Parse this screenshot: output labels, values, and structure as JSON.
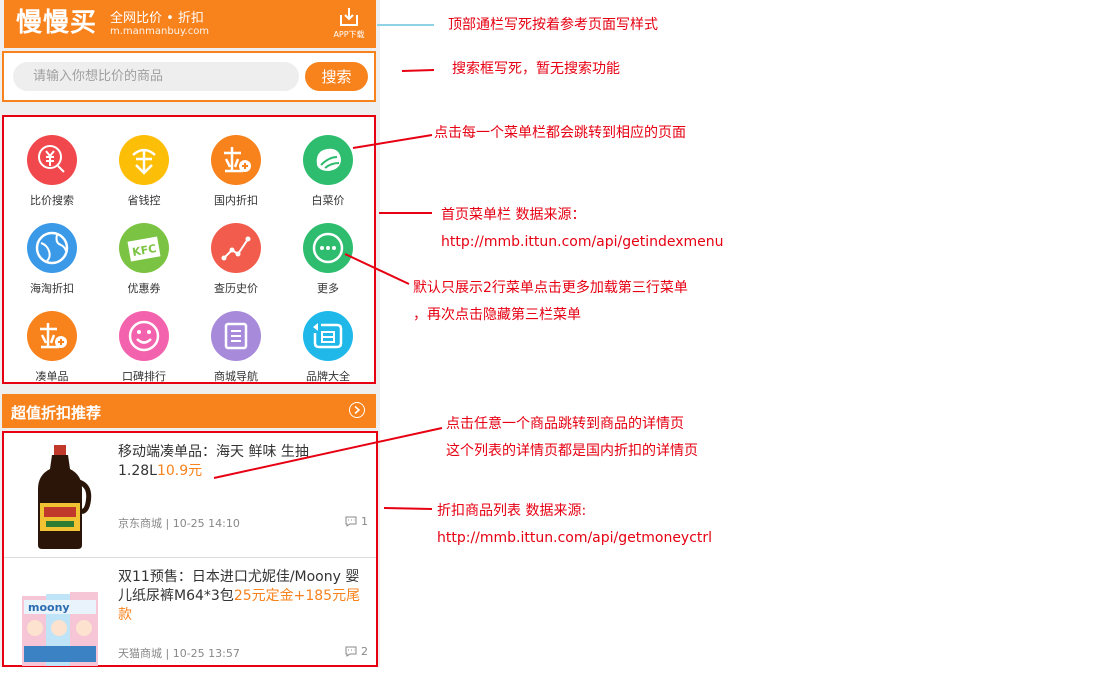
{
  "header": {
    "logo": "慢慢买",
    "slogan": "全网比价 • 折扣",
    "domain": "m.manmanbuy.com",
    "app_download_label": "APP下载",
    "bg_color": "#f8821c"
  },
  "search": {
    "placeholder": "请输入你想比价的商品",
    "button_label": "搜索"
  },
  "menu": {
    "items": [
      {
        "label": "比价搜索",
        "color": "#f0484c",
        "icon": "yen-search-icon"
      },
      {
        "label": "省钱控",
        "color": "#fdbe08",
        "icon": "piggy-save-icon"
      },
      {
        "label": "国内折扣",
        "color": "#f8821c",
        "icon": "discount-plus-icon"
      },
      {
        "label": "白菜价",
        "color": "#2ebd6f",
        "icon": "cabbage-icon"
      },
      {
        "label": "海淘折扣",
        "color": "#3a9ae8",
        "icon": "globe-icon"
      },
      {
        "label": "优惠券",
        "color": "#7bc342",
        "icon": "kfc-coupon-icon"
      },
      {
        "label": "查历史价",
        "color": "#f25c4c",
        "icon": "line-trend-icon"
      },
      {
        "label": "更多",
        "color": "#2ebd6f",
        "icon": "more-dots-icon"
      },
      {
        "label": "凑单品",
        "color": "#f8821c",
        "icon": "bundle-plus-icon"
      },
      {
        "label": "口碑排行",
        "color": "#f363ad",
        "icon": "smile-icon"
      },
      {
        "label": "商城导航",
        "color": "#a78bda",
        "icon": "list-doc-icon"
      },
      {
        "label": "品牌大全",
        "color": "#1fb8e8",
        "icon": "brand-icon"
      }
    ]
  },
  "section": {
    "title": "超值折扣推荐"
  },
  "goods": [
    {
      "title": "移动端凑单品：海天 鲜味 生抽 1.28L",
      "price": "10.9元",
      "store": "京东商城",
      "time": "10-25 14:10",
      "comments": "1"
    },
    {
      "title": "双11预售：日本进口尤妮佳/Moony 婴儿纸尿裤M64*3包",
      "price": "25元定金+185元尾款",
      "store": "天猫商城",
      "time": "10-25 13:57",
      "comments": "2"
    }
  ],
  "annotations": {
    "topbar": "顶部通栏写死按着参考页面写样式",
    "search": "搜索框写死，暂无搜索功能",
    "menu_click": "点击每一个菜单栏都会跳转到相应的页面",
    "menu_source": "首页菜单栏 数据来源：",
    "menu_url": "http://mmb.ittun.com/api/getindexmenu",
    "more_line1": "默认只展示2行菜单点击更多加载第三行菜单",
    "more_line2": "，再次点击隐藏第三栏菜单",
    "goods_click1": "点击任意一个商品跳转到商品的详情页",
    "goods_click2": "这个列表的详情页都是国内折扣的详情页",
    "goods_source": "折扣商品列表  数据来源:",
    "goods_url": "http://mmb.ittun.com/api/getmoneyctrl"
  }
}
